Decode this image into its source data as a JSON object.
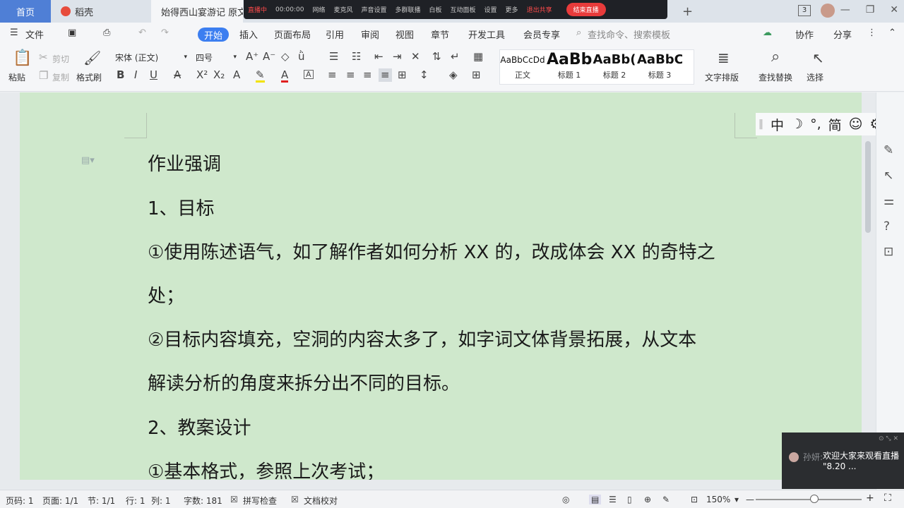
{
  "tabs": {
    "home": "首页",
    "daoke": "稻壳",
    "doc": "始得西山宴游记 原文"
  },
  "livebar": {
    "status": "直播中",
    "time": "00:00:00",
    "items": [
      "网络",
      "麦克风",
      "声音设置",
      "多群联播",
      "白板",
      "互动面板",
      "设置",
      "更多",
      "退出共享"
    ],
    "end_live": "结束直播"
  },
  "titlebar": {
    "badge": "3"
  },
  "menu": {
    "file": "文件",
    "items": [
      "开始",
      "插入",
      "页面布局",
      "引用",
      "审阅",
      "视图",
      "章节",
      "开发工具",
      "会员专享"
    ],
    "active": "开始",
    "search": "查找命令、搜索模板",
    "collab": "协作",
    "share": "分享"
  },
  "ribbon": {
    "paste": "粘贴",
    "cut": "剪切",
    "copy": "复制",
    "format_painter": "格式刷",
    "font_name": "宋体 (正文)",
    "font_size": "四号",
    "styles": [
      {
        "preview": "AaBbCcDd",
        "name": "正文"
      },
      {
        "preview": "AaBb",
        "name": "标题 1"
      },
      {
        "preview": "AaBb(",
        "name": "标题 2"
      },
      {
        "preview": "AaBbC",
        "name": "标题 3"
      }
    ],
    "text_layout": "文字排版",
    "find_replace": "查找替换",
    "select": "选择"
  },
  "ime": {
    "lang": "中",
    "moon": "☽",
    "punct": "°,",
    "simp": "简",
    "emoji": "☺",
    "gear": "⚙"
  },
  "document": {
    "lines": [
      "作业强调",
      "1、目标",
      "①使用陈述语气，如了解作者如何分析 XX 的，改成体会 XX 的奇特之",
      "处；",
      "②目标内容填充，空洞的内容太多了，如字词文体背景拓展，从文本",
      "解读分析的角度来拆分出不同的目标。",
      "2、教案设计",
      "①基本格式，参照上次考试；"
    ]
  },
  "status": {
    "page_code": "页码: 1",
    "page": "页面: 1/1",
    "section": "节: 1/1",
    "row": "行: 1",
    "col": "列: 1",
    "word_count": "字数: 181",
    "spell_check": "拼写检查",
    "proofread": "文档校对",
    "zoom": "150%",
    "zoom_level": 1.5
  },
  "chat": {
    "name": "孙妍:",
    "message": "欢迎大家来观看直播 \"8.20 ..."
  }
}
